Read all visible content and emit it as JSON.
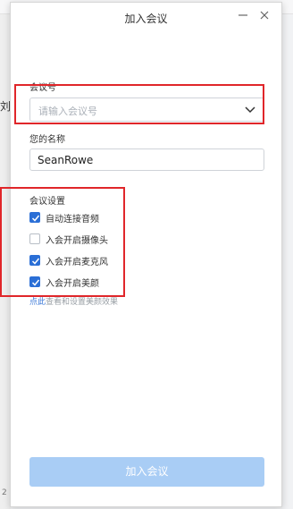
{
  "dialog": {
    "title": "加入会议",
    "meeting_id_label": "会议号",
    "meeting_id_placeholder": "请输入会议号",
    "name_label": "您的名称",
    "name_value": "SeanRowe",
    "settings_label": "会议设置",
    "options": [
      {
        "label": "自动连接音频",
        "checked": true
      },
      {
        "label": "入会开启摄像头",
        "checked": false
      },
      {
        "label": "入会开启麦克风",
        "checked": true
      },
      {
        "label": "入会开启美颜",
        "checked": true
      }
    ],
    "hint_link": "点此",
    "hint_text": "查看和设置美颜效果",
    "join_button": "加入会议"
  },
  "background": {
    "side_text": "刘",
    "line_number": "2"
  },
  "colors": {
    "accent": "#2b6fd6",
    "join_button_disabled": "#a9cdf5",
    "annotation": "#e0262a"
  }
}
